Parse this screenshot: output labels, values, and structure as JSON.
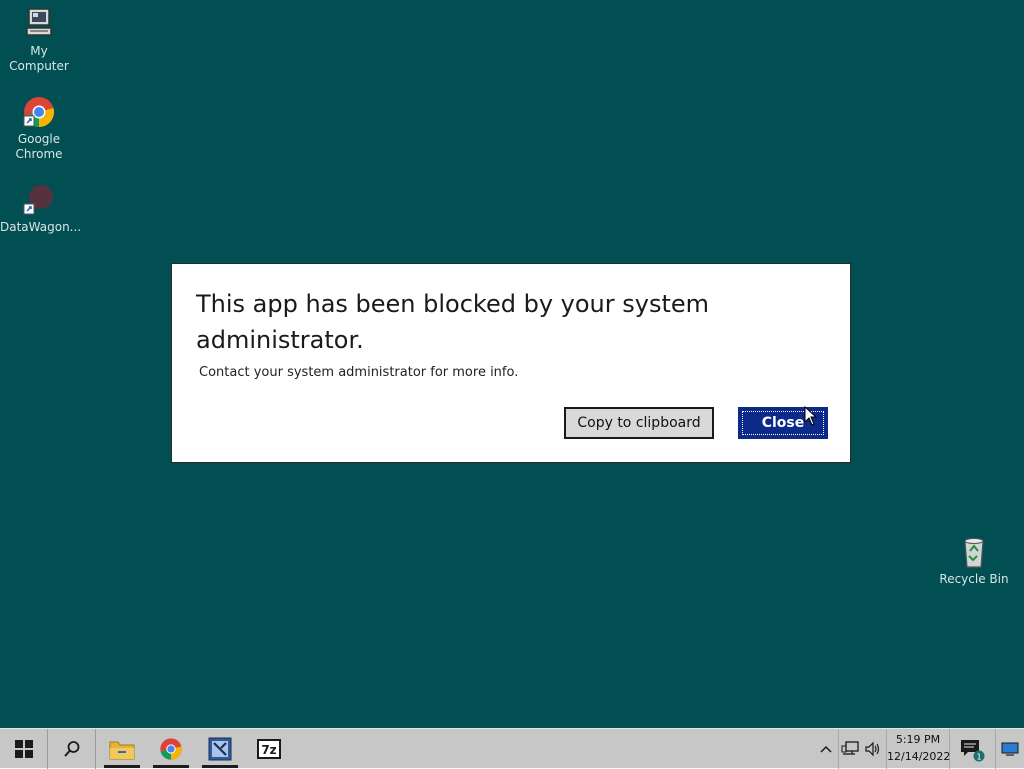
{
  "desktop": {
    "background": "#014f52",
    "icons": [
      {
        "label": "My Computer",
        "icon": "computer-icon"
      },
      {
        "label": "Google Chrome",
        "icon": "chrome-icon"
      },
      {
        "label": "DataWagon...",
        "icon": "shortcut-icon"
      },
      {
        "label": "Recycle Bin",
        "icon": "recycle-bin-icon"
      }
    ]
  },
  "dialog": {
    "title": "This app has been blocked by your system administrator.",
    "message": "Contact your system administrator for more info.",
    "copy_label": "Copy to clipboard",
    "close_label": "Close",
    "accent": "#0b2a8a"
  },
  "taskbar": {
    "background": "#c7c7c7",
    "start_icon": "windows-start-icon",
    "search_icon": "search-icon",
    "apps": [
      {
        "name": "File Explorer",
        "icon": "folder-icon"
      },
      {
        "name": "Google Chrome",
        "icon": "chrome-icon"
      },
      {
        "name": "App",
        "icon": "tool-icon"
      },
      {
        "name": "7-Zip",
        "icon": "7zip-icon"
      }
    ],
    "tray": {
      "show_hidden_icon": "chevron-up-icon",
      "network_icon": "network-icon",
      "volume_icon": "volume-icon",
      "time": "5:19 PM",
      "date": "12/14/2022",
      "notifications_icon": "action-center-icon",
      "notification_count": "1",
      "show_desktop_icon": "show-desktop-icon"
    }
  }
}
